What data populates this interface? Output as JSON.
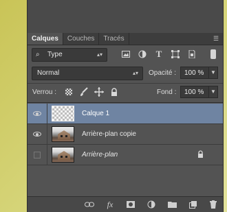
{
  "panel": {
    "tabs": [
      "Calques",
      "Couches",
      "Tracés"
    ],
    "active_tab": "Calques",
    "menu_icon": "☰"
  },
  "filter": {
    "type_label": "Type",
    "icons": [
      "image-filter-icon",
      "adjustment-filter-icon",
      "type-filter-icon",
      "shape-filter-icon",
      "smart-object-filter-icon"
    ]
  },
  "blend": {
    "mode": "Normal",
    "opacity_label": "Opacité :",
    "opacity_value": "100 %"
  },
  "lock": {
    "label": "Verrou :",
    "icons": [
      "lock-transparent-pixels-icon",
      "lock-image-pixels-icon",
      "lock-position-icon",
      "lock-all-icon"
    ],
    "fill_label": "Fond :",
    "fill_value": "100 %"
  },
  "layers": [
    {
      "name": "Calque 1",
      "selected": true,
      "visible": true,
      "italic": false,
      "locked": false,
      "thumb": "transparent"
    },
    {
      "name": "Arrière-plan copie",
      "selected": false,
      "visible": true,
      "italic": false,
      "locked": false,
      "thumb": "photo"
    },
    {
      "name": "Arrière-plan",
      "selected": false,
      "visible": false,
      "italic": true,
      "locked": true,
      "thumb": "photo"
    }
  ],
  "bottom_toolbar": [
    "link-layers-icon",
    "fx-icon",
    "mask-icon",
    "adjustment-layer-icon",
    "folder-icon",
    "new-layer-icon",
    "trash-icon"
  ],
  "colors": {
    "panel_bg": "#535353",
    "selected_layer": "#6f84a2",
    "background": "#d6d57a"
  }
}
